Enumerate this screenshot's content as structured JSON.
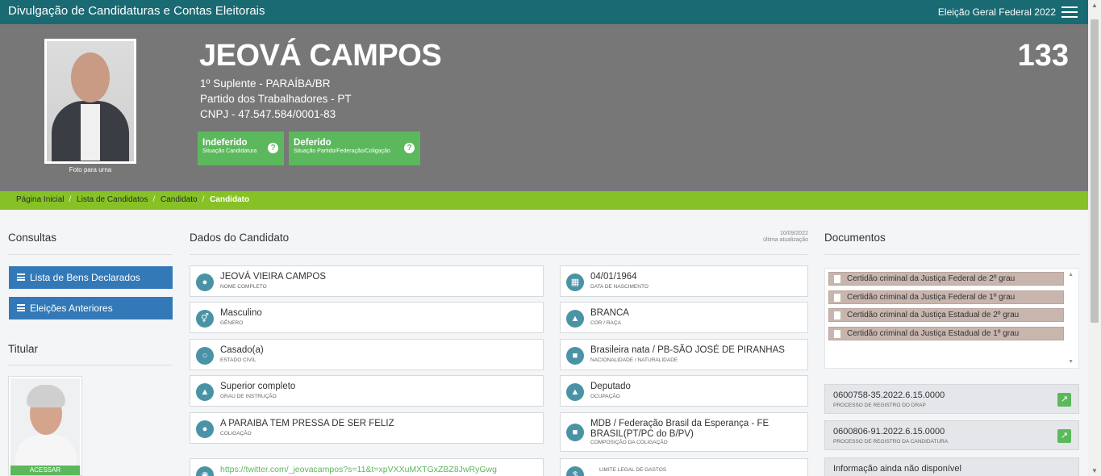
{
  "topbar": {
    "app_title": "Divulgação de Candidaturas e Contas Eleitorais",
    "election": "Eleição Geral Federal 2022",
    "menu_icon": "hamburger-menu-icon"
  },
  "candidate": {
    "photo_caption": "Foto para urna",
    "name": "JEOVÁ CAMPOS",
    "position": "1º Suplente - PARAÍBA/BR",
    "party": "Partido dos Trabalhadores - PT",
    "cnpj": "CNPJ - 47.547.584/0001-83",
    "number": "133"
  },
  "statuses": [
    {
      "title": "Indeferido",
      "subtitle": "Situação Candidatura",
      "icon": "question-circle-icon"
    },
    {
      "title": "Deferido",
      "subtitle": "Situação Partido/Federação/Coligação",
      "icon": "question-circle-icon"
    }
  ],
  "breadcrumb": [
    "Página Inicial",
    "Lista de Candidatos",
    "Candidato",
    "Candidato"
  ],
  "consultas": {
    "title": "Consultas",
    "buttons": [
      "Lista de Bens Declarados",
      "Eleições Anteriores"
    ]
  },
  "titular": {
    "title": "Titular",
    "action": "ACESSAR"
  },
  "dados": {
    "title": "Dados do Candidato",
    "update_date": "10/09/2022",
    "update_label": "última atualização",
    "fields": [
      {
        "value": "JEOVÁ VIEIRA CAMPOS",
        "label": "Nome completo",
        "icon": "user-icon"
      },
      {
        "value": "04/01/1964",
        "label": "Data de nascimento",
        "icon": "calendar-icon"
      },
      {
        "value": "Masculino",
        "label": "Gênero",
        "icon": "gender-icon"
      },
      {
        "value": "BRANCA",
        "label": "Cor / Raça",
        "icon": "person-icon"
      },
      {
        "value": "Casado(a)",
        "label": "Estado civil",
        "icon": "ring-icon"
      },
      {
        "value": "Brasileira nata / PB-SÃO JOSÉ DE PIRANHAS",
        "label": "Nacionalidade / Naturalidade",
        "icon": "map-icon"
      },
      {
        "value": "Superior completo",
        "label": "Grau de instrução",
        "icon": "graduation-cap-icon"
      },
      {
        "value": "Deputado",
        "label": "Ocupação",
        "icon": "institution-icon"
      },
      {
        "value": "A PARAIBA TEM PRESSA DE SER FELIZ",
        "label": "Coligação",
        "icon": "people-icon"
      },
      {
        "value": "MDB / Federação Brasil da Esperança - FE BRASIL(PT/PC do B/PV)",
        "label": "Composição da coligação",
        "icon": "folder-icon"
      },
      {
        "value": "https://twitter.com/_jeovacampos?s=11&t=xpVXXuMXTGxZBZ8JwRyGwg",
        "label": "",
        "icon": "globe-icon"
      },
      {
        "value": "",
        "label": "Limite legal de gastos",
        "icon": "dollar-icon"
      }
    ]
  },
  "documentos": {
    "title": "Documentos",
    "items": [
      "Certidão criminal da Justiça Federal de 2º grau",
      "Certidão criminal da Justiça Federal de 1º grau",
      "Certidão criminal da Justiça Estadual de 2º grau",
      "Certidão criminal da Justiça Estadual de 1º grau"
    ],
    "processes": [
      {
        "number": "0600758-35.2022.6.15.0000",
        "label": "Processo de registro do DRAP"
      },
      {
        "number": "0600806-91.2022.6.15.0000",
        "label": "Processo de registro da candidatura"
      }
    ],
    "unavailable": "Informação ainda não disponível"
  },
  "colors": {
    "topbar": "#1a6a73",
    "hero": "#777777",
    "breadcrumb": "#86c226",
    "status_green": "#5cb85c",
    "button_blue": "#3379b7",
    "field_icon": "#4a93a6",
    "document_item": "#c8b5ae"
  }
}
